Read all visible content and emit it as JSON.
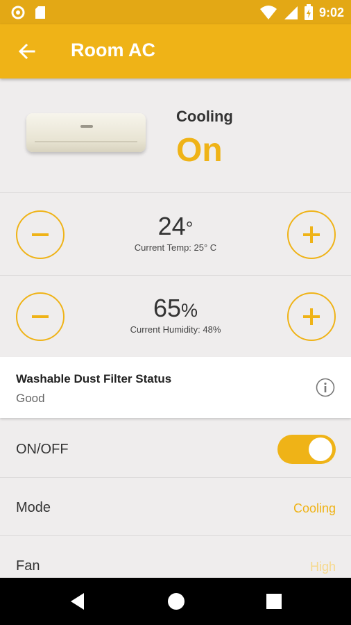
{
  "status_bar": {
    "time": "9:02",
    "icons": [
      "circle-notification-icon",
      "sd-card-icon",
      "wifi-icon",
      "signal-icon",
      "battery-charging-icon"
    ]
  },
  "app_bar": {
    "title": "Room AC",
    "back_icon": "arrow-left-icon"
  },
  "device": {
    "mode_label": "Cooling",
    "power_state": "On"
  },
  "temperature": {
    "value": "24",
    "unit": "°",
    "current": "Current Temp: 25° C"
  },
  "humidity": {
    "value": "65",
    "unit": "%",
    "current": "Current Humidity: 48%"
  },
  "filter": {
    "title": "Washable Dust Filter Status",
    "status": "Good"
  },
  "settings": {
    "onoff_label": "ON/OFF",
    "onoff_state": true,
    "mode_label": "Mode",
    "mode_value": "Cooling",
    "fan_label": "Fan",
    "fan_value": "High"
  },
  "colors": {
    "accent": "#efb317",
    "status_bar": "#e3a815",
    "background": "#efeded"
  }
}
